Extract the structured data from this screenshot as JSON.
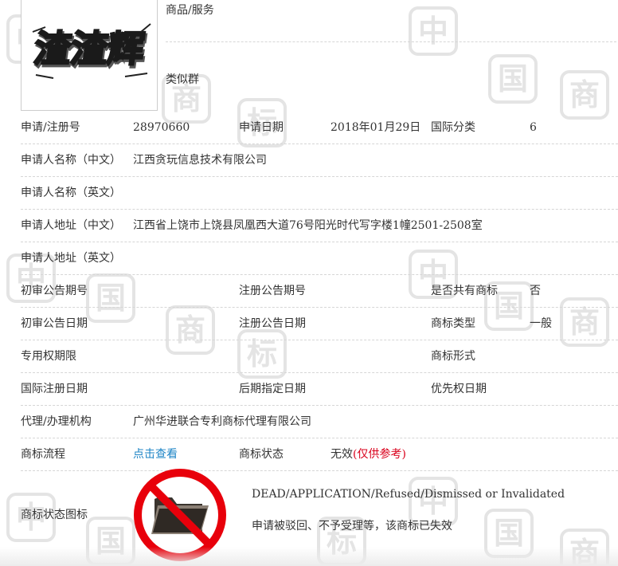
{
  "logo": {
    "mark_text": "渣渣辉"
  },
  "goods_section": {
    "goods_label": "商品/服务",
    "similar_label": "类似群"
  },
  "rows": {
    "reg_no_label": "申请/注册号",
    "reg_no_value": "28970660",
    "app_date_label": "申请日期",
    "app_date_value": "2018年01月29日",
    "intl_class_label": "国际分类",
    "intl_class_value": "6",
    "applicant_cn_label": "申请人名称（中文）",
    "applicant_cn_value": "江西贪玩信息技术有限公司",
    "applicant_en_label": "申请人名称（英文）",
    "address_cn_label": "申请人地址（中文）",
    "address_cn_value": "江西省上饶市上饶县凤凰西大道76号阳光时代写字楼1幢2501-2508室",
    "address_en_label": "申请人地址（英文）",
    "prelim_pub_no_label": "初审公告期号",
    "reg_pub_no_label": "注册公告期号",
    "shared_label": "是否共有商标",
    "shared_value": "否",
    "prelim_pub_date_label": "初审公告日期",
    "reg_pub_date_label": "注册公告日期",
    "tm_type_label": "商标类型",
    "tm_type_value": "一般",
    "exclusive_period_label": "专用权期限",
    "tm_form_label": "商标形式",
    "intl_reg_date_label": "国际注册日期",
    "later_designation_label": "后期指定日期",
    "priority_date_label": "优先权日期",
    "agent_label": "代理/办理机构",
    "agent_value": "广州华进联合专利商标代理有限公司",
    "process_label": "商标流程",
    "process_link": "点击查看",
    "status_label": "商标状态",
    "status_value": "无效",
    "status_note": "(仅供参考)"
  },
  "status_icon": {
    "label": "商标状态图标",
    "en_text": "DEAD/APPLICATION/Refused/Dismissed or Invalidated",
    "cn_text": "申请被驳回、不予受理等，该商标已失效"
  },
  "watermark": {
    "chars": [
      "中",
      "国",
      "商",
      "标"
    ]
  },
  "colors": {
    "link": "#1d84c6",
    "invalid_note": "#d9001b",
    "forbidden_red": "#e8000b",
    "folder": "#3a342e",
    "watermark": "#e4e4e4"
  }
}
